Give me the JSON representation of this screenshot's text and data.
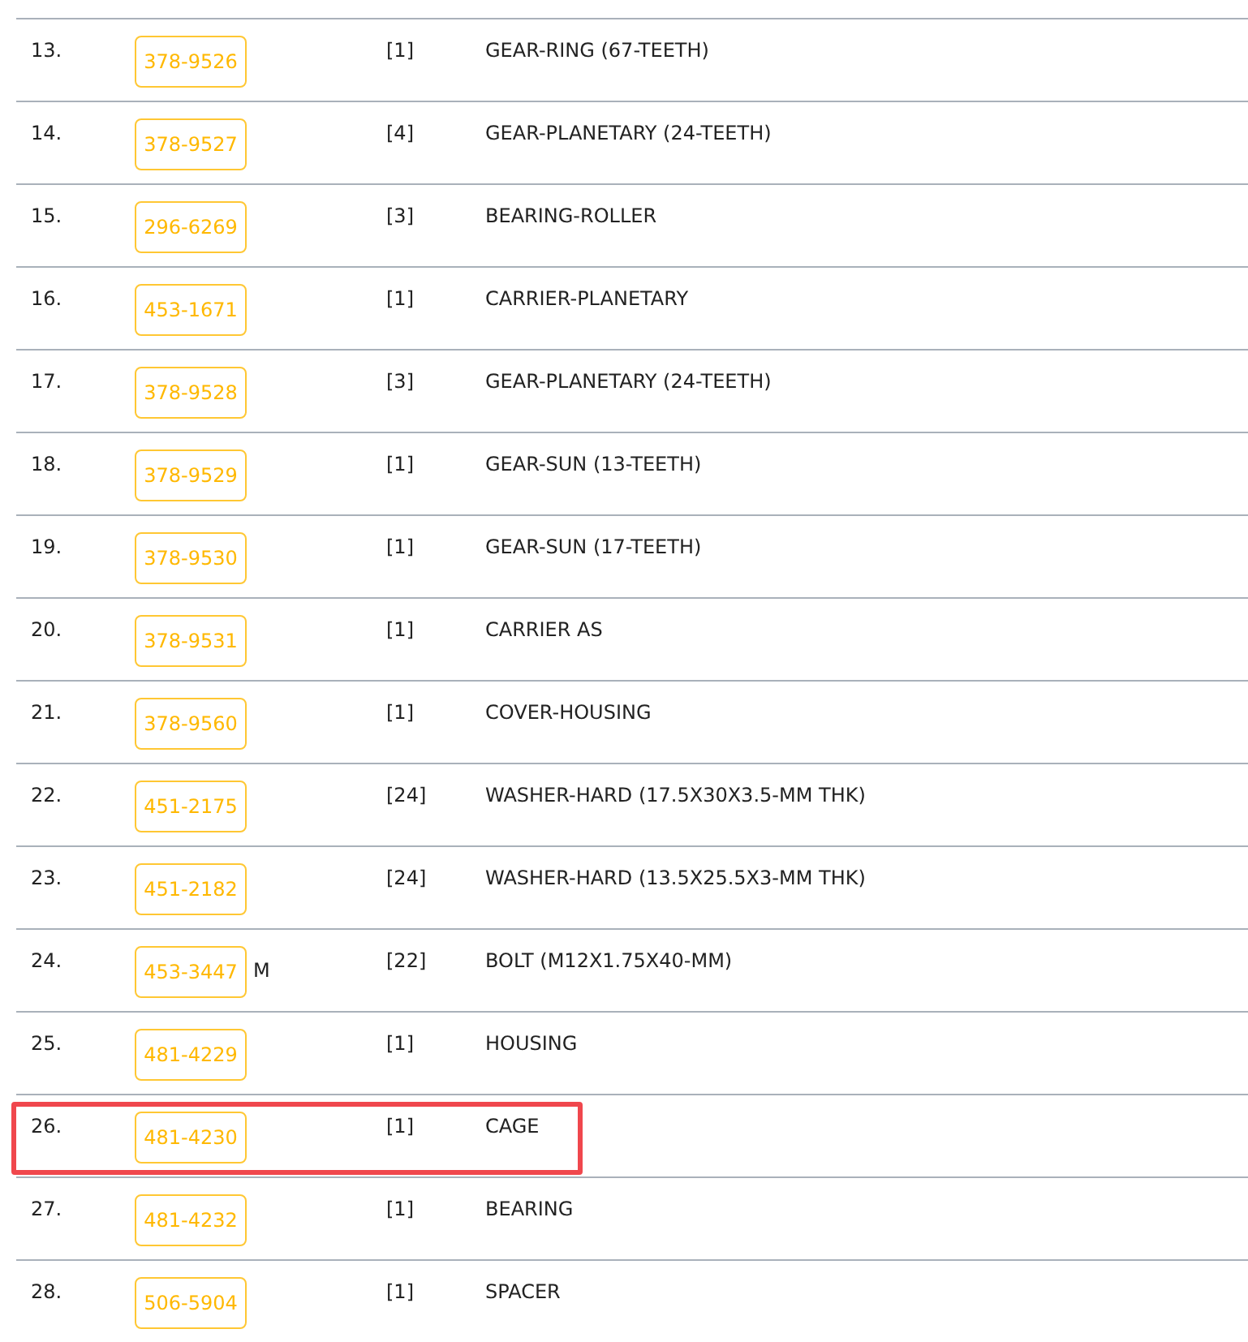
{
  "parts": [
    {
      "number": "13.",
      "part_no": "378-9526",
      "qty": "[1]",
      "description": "GEAR-RING (67-TEETH)",
      "highlighted": false
    },
    {
      "number": "14.",
      "part_no": "378-9527",
      "qty": "[4]",
      "description": "GEAR-PLANETARY (24-TEETH)",
      "highlighted": false
    },
    {
      "number": "15.",
      "part_no": "296-6269",
      "qty": "[3]",
      "description": "BEARING-ROLLER",
      "highlighted": false
    },
    {
      "number": "16.",
      "part_no": "453-1671",
      "qty": "[1]",
      "description": "CARRIER-PLANETARY",
      "highlighted": false
    },
    {
      "number": "17.",
      "part_no": "378-9528",
      "qty": "[3]",
      "description": "GEAR-PLANETARY (24-TEETH)",
      "highlighted": false
    },
    {
      "number": "18.",
      "part_no": "378-9529",
      "qty": "[1]",
      "description": "GEAR-SUN (13-TEETH)",
      "highlighted": false
    },
    {
      "number": "19.",
      "part_no": "378-9530",
      "qty": "[1]",
      "description": "GEAR-SUN (17-TEETH)",
      "highlighted": false
    },
    {
      "number": "20.",
      "part_no": "378-9531",
      "qty": "[1]",
      "description": "CARRIER AS",
      "highlighted": false
    },
    {
      "number": "21.",
      "part_no": "378-9560",
      "qty": "[1]",
      "description": "COVER-HOUSING",
      "highlighted": false
    },
    {
      "number": "22.",
      "part_no": "451-2175",
      "qty": "[24]",
      "description": "WASHER-HARD (17.5X30X3.5-MM THK)",
      "highlighted": false
    },
    {
      "number": "23.",
      "part_no": "451-2182",
      "qty": "[24]",
      "description": "WASHER-HARD (13.5X25.5X3-MM THK)",
      "highlighted": false
    },
    {
      "number": "24.",
      "part_no": "453-3447",
      "suffix": "M",
      "qty": "[22]",
      "description": "BOLT (M12X1.75X40-MM)",
      "highlighted": false
    },
    {
      "number": "25.",
      "part_no": "481-4229",
      "qty": "[1]",
      "description": "HOUSING",
      "highlighted": false
    },
    {
      "number": "26.",
      "part_no": "481-4230",
      "qty": "[1]",
      "description": "CAGE",
      "highlighted": true
    },
    {
      "number": "27.",
      "part_no": "481-4232",
      "qty": "[1]",
      "description": "BEARING",
      "highlighted": false
    },
    {
      "number": "28.",
      "part_no": "506-5904",
      "qty": "[1]",
      "description": "SPACER",
      "highlighted": false
    }
  ]
}
